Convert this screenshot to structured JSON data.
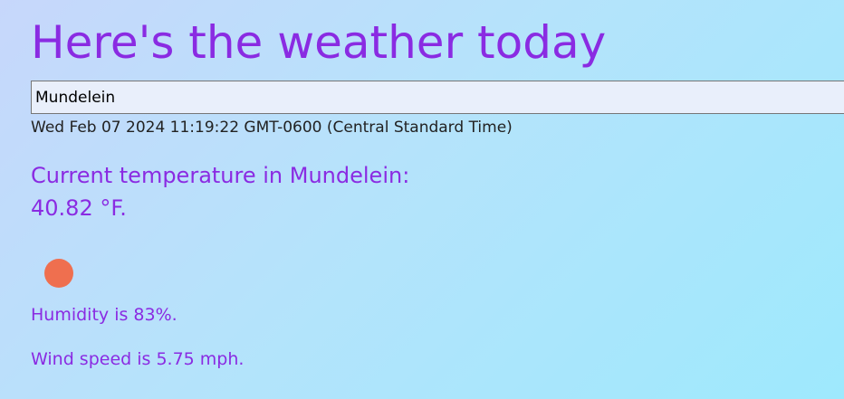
{
  "page": {
    "title": "Here's the weather today"
  },
  "search": {
    "value": "Mundelein"
  },
  "datetime": "Wed Feb 07 2024 11:19:22 GMT-0600 (Central Standard Time)",
  "current": {
    "temperature_label": "Current temperature in Mundelein:",
    "temperature_value": "40.82 °F.",
    "icon": "sun-icon",
    "humidity_text": "Humidity is 83%.",
    "wind_text": "Wind speed is 5.75 mph."
  },
  "colors": {
    "accent": "#8a2be2",
    "icon": "#ef6f4f",
    "background_start": "#c7d7fb",
    "background_end": "#9ee9fd"
  }
}
